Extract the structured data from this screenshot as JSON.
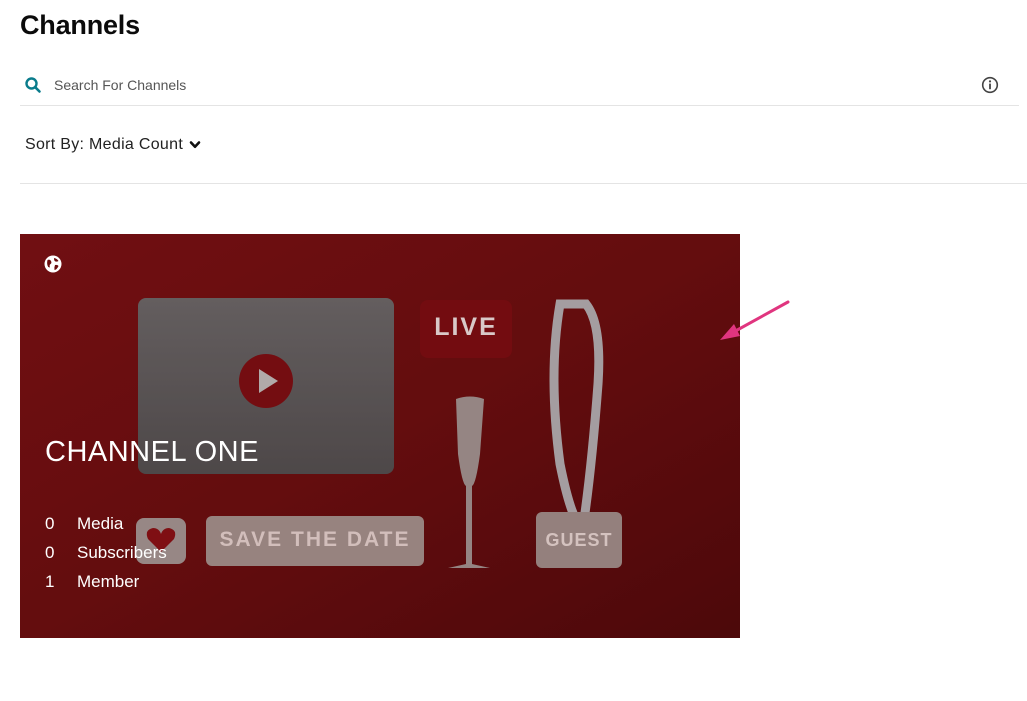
{
  "header": {
    "title": "Channels"
  },
  "search": {
    "placeholder": "Search For Channels",
    "value": ""
  },
  "sort": {
    "label": "Sort By: Media Count"
  },
  "channel_card": {
    "name": "CHANNEL ONE",
    "art_labels": {
      "live": "LIVE",
      "save_the_date": "SAVE THE DATE",
      "guest": "GUEST"
    },
    "stats": [
      {
        "count": "0",
        "label": "Media"
      },
      {
        "count": "0",
        "label": "Subscribers"
      },
      {
        "count": "1",
        "label": "Member"
      }
    ]
  },
  "colors": {
    "accent": "#0a7c8c",
    "card_background": "#7a0f12",
    "arrow": "#e0357f"
  },
  "icons": {
    "search": "search-icon",
    "info": "info-icon",
    "sort": "chevron-down-icon",
    "privacy": "globe-icon",
    "annotation": "arrow-icon"
  }
}
